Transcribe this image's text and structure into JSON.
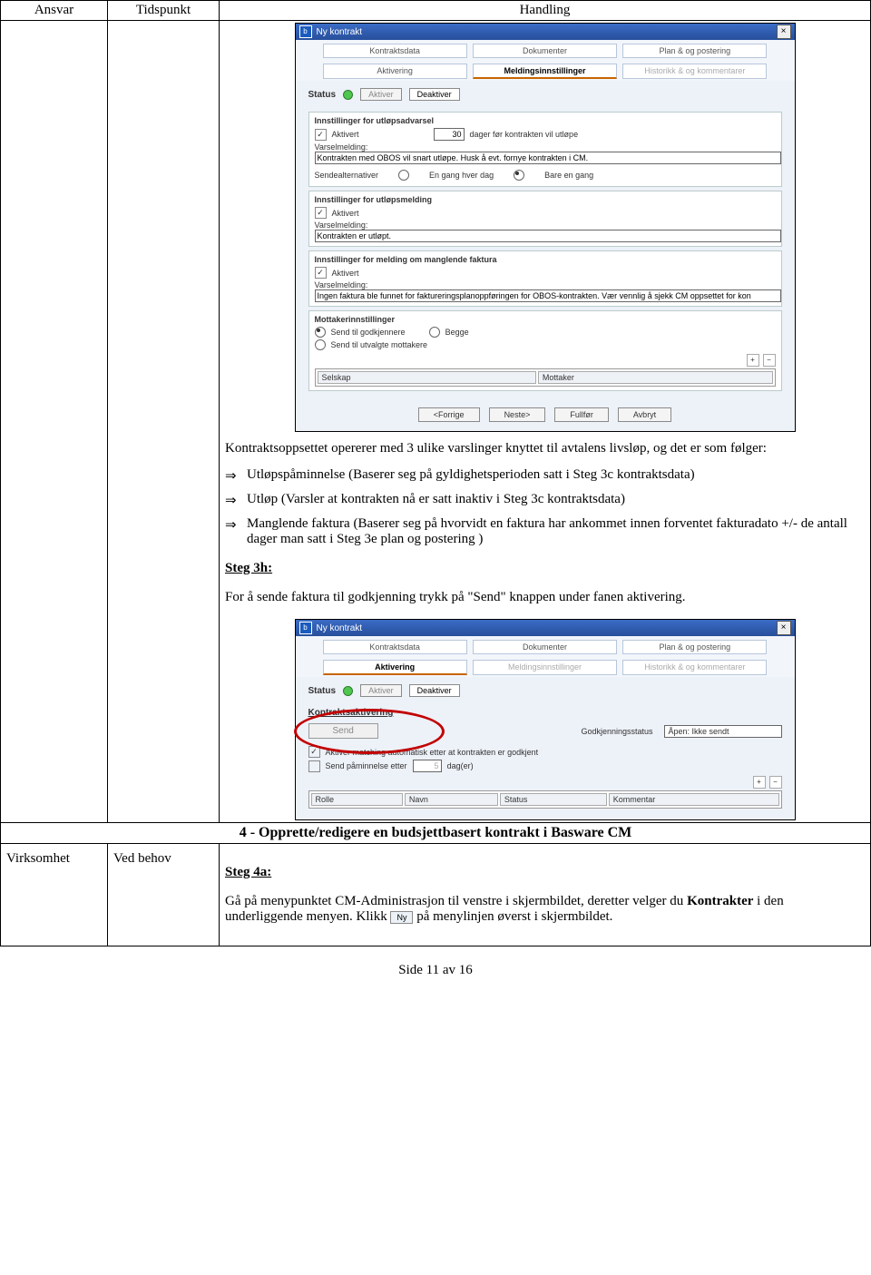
{
  "header": {
    "ansvar": "Ansvar",
    "tidspunkt": "Tidspunkt",
    "handling": "Handling"
  },
  "body": {
    "intro": "Kontraktsoppsettet opererer med 3 ulike varslinger knyttet til avtalens livsløp, og det er som følger:",
    "bullets": [
      "Utløpspåminnelse (Baserer seg på gyldighetsperioden satt i Steg 3c kontraktsdata)",
      "Utløp (Varsler at kontrakten nå er satt inaktiv i Steg 3c kontraktsdata)",
      "Manglende faktura (Baserer seg på hvorvidt en faktura har ankommet innen forventet fakturadato +/- de antall dager man satt i Steg 3e plan og postering )"
    ],
    "step3h": "Steg 3h:",
    "step3h_text": "For å sende faktura til godkjenning trykk på \"Send\" knappen under fanen aktivering."
  },
  "section4": {
    "title": "4 - Opprette/redigere en budsjettbasert kontrakt i Basware CM",
    "virksomhet": "Virksomhet",
    "vedbehov": "Ved behov",
    "step4a": "Steg 4a:",
    "text1": "Gå på menypunktet CM-Administrasjon til venstre i skjermbildet, deretter velger du ",
    "kontrakter": "Kontrakter",
    "text2": " i den underliggende menyen. Klikk ",
    "btn": "Ny",
    "text3": " på menylinjen øverst i skjermbildet."
  },
  "footer": "Side 11 av 16",
  "dlg1": {
    "title": "Ny kontrakt",
    "tabs1": [
      "Kontraktsdata",
      "Dokumenter",
      "Plan & og postering"
    ],
    "tabs2": [
      "Aktivering",
      "Meldingsinnstillinger",
      "Historikk & og kommentarer"
    ],
    "status": "Status",
    "aktiver": "Aktiver",
    "deaktiver": "Deaktiver",
    "g1": "Innstillinger for utløpsadvarsel",
    "aktivert": "Aktivert",
    "days": "30",
    "daystxt": "dager før kontrakten vil utløpe",
    "varsel": "Varselmelding:",
    "vm1": "Kontrakten med OBOS vil snart utløpe. Husk å evt. fornye kontrakten i CM.",
    "sendalt": "Sendealternativer",
    "r1": "En gang hver dag",
    "r2": "Bare en gang",
    "g2": "Innstillinger for utløpsmelding",
    "vm2": "Kontrakten er utløpt.",
    "g3": "Innstillinger for melding om manglende faktura",
    "vm3": "Ingen faktura ble funnet for faktureringsplanoppføringen for OBOS-kontrakten. Vær vennlig å sjekk CM oppsettet for kon",
    "g4": "Mottakerinnstillinger",
    "m1": "Send til godkjennere",
    "m2": "Begge",
    "m3": "Send til utvalgte mottakere",
    "thSelskap": "Selskap",
    "thMottaker": "Mottaker",
    "btns": [
      "<Forrige",
      "Neste>",
      "Fullfør",
      "Avbryt"
    ]
  },
  "dlg2": {
    "title": "Ny kontrakt",
    "tabs1": [
      "Kontraktsdata",
      "Dokumenter",
      "Plan & og postering"
    ],
    "tabs2": [
      "Aktivering",
      "Meldingsinnstillinger",
      "Historikk & og kommentarer"
    ],
    "status": "Status",
    "aktiver": "Aktiver",
    "deaktiver": "Deaktiver",
    "grp": "Kontraktsaktivering",
    "send": "Send",
    "gstatus": "Godkjenningsstatus",
    "gvalue": "Åpen: Ikke sendt",
    "chk1": "Aktiver matching automatisk etter at kontrakten er godkjent",
    "chk2": "Send påminnelse etter",
    "days": "5",
    "dager": "dag(er)",
    "th": [
      "Rolle",
      "Navn",
      "Status",
      "Kommentar"
    ]
  }
}
